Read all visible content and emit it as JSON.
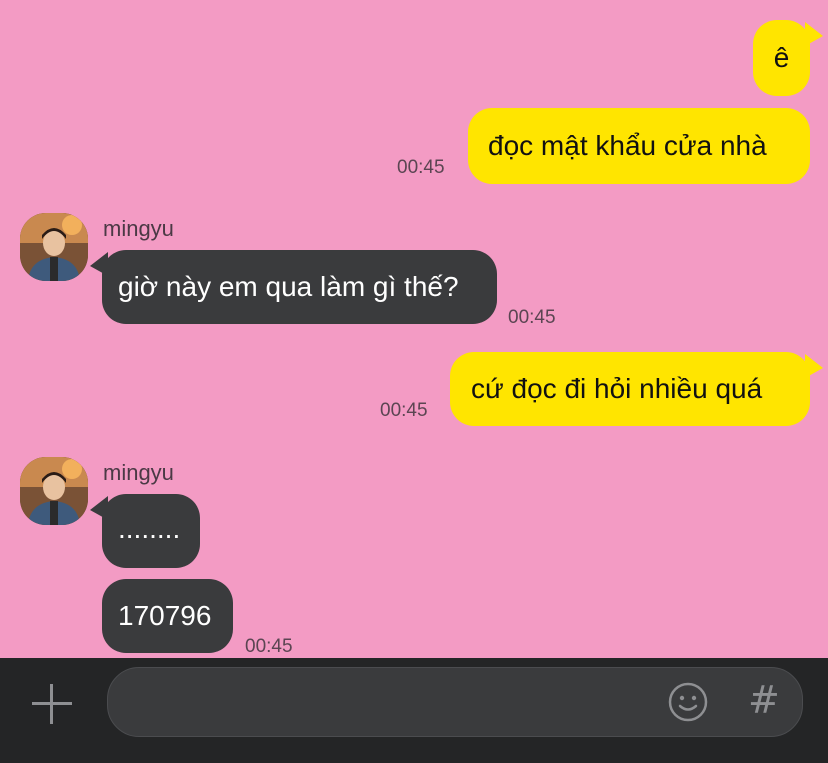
{
  "messages": [
    {
      "from": "me",
      "text": "ê"
    },
    {
      "from": "me",
      "text": "đọc mật khẩu cửa nhà",
      "time": "00:45"
    },
    {
      "from": "them",
      "sender": "mingyu",
      "text": "giờ này em qua làm gì thế?",
      "time": "00:45"
    },
    {
      "from": "me",
      "text": "cứ đọc đi hỏi nhiều quá",
      "time": "00:45"
    },
    {
      "from": "them",
      "sender": "mingyu",
      "text": "........"
    },
    {
      "from": "them",
      "text": "170796",
      "time": "00:45"
    }
  ],
  "composer": {
    "value": "",
    "placeholder": "",
    "hash_label": "#"
  },
  "colors": {
    "background": "#f39bc4",
    "my_bubble": "#ffe500",
    "their_bubble": "#3a3b3d",
    "input_bar": "#242526"
  },
  "icons": [
    "plus-icon",
    "emoji-icon",
    "hash-icon"
  ]
}
